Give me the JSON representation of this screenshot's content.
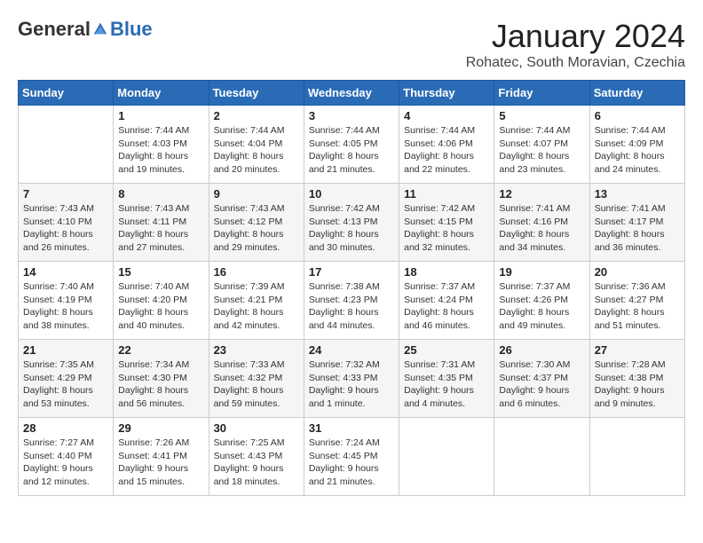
{
  "header": {
    "logo_general": "General",
    "logo_blue": "Blue",
    "month_title": "January 2024",
    "location": "Rohatec, South Moravian, Czechia"
  },
  "weekdays": [
    "Sunday",
    "Monday",
    "Tuesday",
    "Wednesday",
    "Thursday",
    "Friday",
    "Saturday"
  ],
  "weeks": [
    [
      {
        "day": "",
        "sunrise": "",
        "sunset": "",
        "daylight": ""
      },
      {
        "day": "1",
        "sunrise": "Sunrise: 7:44 AM",
        "sunset": "Sunset: 4:03 PM",
        "daylight": "Daylight: 8 hours and 19 minutes."
      },
      {
        "day": "2",
        "sunrise": "Sunrise: 7:44 AM",
        "sunset": "Sunset: 4:04 PM",
        "daylight": "Daylight: 8 hours and 20 minutes."
      },
      {
        "day": "3",
        "sunrise": "Sunrise: 7:44 AM",
        "sunset": "Sunset: 4:05 PM",
        "daylight": "Daylight: 8 hours and 21 minutes."
      },
      {
        "day": "4",
        "sunrise": "Sunrise: 7:44 AM",
        "sunset": "Sunset: 4:06 PM",
        "daylight": "Daylight: 8 hours and 22 minutes."
      },
      {
        "day": "5",
        "sunrise": "Sunrise: 7:44 AM",
        "sunset": "Sunset: 4:07 PM",
        "daylight": "Daylight: 8 hours and 23 minutes."
      },
      {
        "day": "6",
        "sunrise": "Sunrise: 7:44 AM",
        "sunset": "Sunset: 4:09 PM",
        "daylight": "Daylight: 8 hours and 24 minutes."
      }
    ],
    [
      {
        "day": "7",
        "sunrise": "Sunrise: 7:43 AM",
        "sunset": "Sunset: 4:10 PM",
        "daylight": "Daylight: 8 hours and 26 minutes."
      },
      {
        "day": "8",
        "sunrise": "Sunrise: 7:43 AM",
        "sunset": "Sunset: 4:11 PM",
        "daylight": "Daylight: 8 hours and 27 minutes."
      },
      {
        "day": "9",
        "sunrise": "Sunrise: 7:43 AM",
        "sunset": "Sunset: 4:12 PM",
        "daylight": "Daylight: 8 hours and 29 minutes."
      },
      {
        "day": "10",
        "sunrise": "Sunrise: 7:42 AM",
        "sunset": "Sunset: 4:13 PM",
        "daylight": "Daylight: 8 hours and 30 minutes."
      },
      {
        "day": "11",
        "sunrise": "Sunrise: 7:42 AM",
        "sunset": "Sunset: 4:15 PM",
        "daylight": "Daylight: 8 hours and 32 minutes."
      },
      {
        "day": "12",
        "sunrise": "Sunrise: 7:41 AM",
        "sunset": "Sunset: 4:16 PM",
        "daylight": "Daylight: 8 hours and 34 minutes."
      },
      {
        "day": "13",
        "sunrise": "Sunrise: 7:41 AM",
        "sunset": "Sunset: 4:17 PM",
        "daylight": "Daylight: 8 hours and 36 minutes."
      }
    ],
    [
      {
        "day": "14",
        "sunrise": "Sunrise: 7:40 AM",
        "sunset": "Sunset: 4:19 PM",
        "daylight": "Daylight: 8 hours and 38 minutes."
      },
      {
        "day": "15",
        "sunrise": "Sunrise: 7:40 AM",
        "sunset": "Sunset: 4:20 PM",
        "daylight": "Daylight: 8 hours and 40 minutes."
      },
      {
        "day": "16",
        "sunrise": "Sunrise: 7:39 AM",
        "sunset": "Sunset: 4:21 PM",
        "daylight": "Daylight: 8 hours and 42 minutes."
      },
      {
        "day": "17",
        "sunrise": "Sunrise: 7:38 AM",
        "sunset": "Sunset: 4:23 PM",
        "daylight": "Daylight: 8 hours and 44 minutes."
      },
      {
        "day": "18",
        "sunrise": "Sunrise: 7:37 AM",
        "sunset": "Sunset: 4:24 PM",
        "daylight": "Daylight: 8 hours and 46 minutes."
      },
      {
        "day": "19",
        "sunrise": "Sunrise: 7:37 AM",
        "sunset": "Sunset: 4:26 PM",
        "daylight": "Daylight: 8 hours and 49 minutes."
      },
      {
        "day": "20",
        "sunrise": "Sunrise: 7:36 AM",
        "sunset": "Sunset: 4:27 PM",
        "daylight": "Daylight: 8 hours and 51 minutes."
      }
    ],
    [
      {
        "day": "21",
        "sunrise": "Sunrise: 7:35 AM",
        "sunset": "Sunset: 4:29 PM",
        "daylight": "Daylight: 8 hours and 53 minutes."
      },
      {
        "day": "22",
        "sunrise": "Sunrise: 7:34 AM",
        "sunset": "Sunset: 4:30 PM",
        "daylight": "Daylight: 8 hours and 56 minutes."
      },
      {
        "day": "23",
        "sunrise": "Sunrise: 7:33 AM",
        "sunset": "Sunset: 4:32 PM",
        "daylight": "Daylight: 8 hours and 59 minutes."
      },
      {
        "day": "24",
        "sunrise": "Sunrise: 7:32 AM",
        "sunset": "Sunset: 4:33 PM",
        "daylight": "Daylight: 9 hours and 1 minute."
      },
      {
        "day": "25",
        "sunrise": "Sunrise: 7:31 AM",
        "sunset": "Sunset: 4:35 PM",
        "daylight": "Daylight: 9 hours and 4 minutes."
      },
      {
        "day": "26",
        "sunrise": "Sunrise: 7:30 AM",
        "sunset": "Sunset: 4:37 PM",
        "daylight": "Daylight: 9 hours and 6 minutes."
      },
      {
        "day": "27",
        "sunrise": "Sunrise: 7:28 AM",
        "sunset": "Sunset: 4:38 PM",
        "daylight": "Daylight: 9 hours and 9 minutes."
      }
    ],
    [
      {
        "day": "28",
        "sunrise": "Sunrise: 7:27 AM",
        "sunset": "Sunset: 4:40 PM",
        "daylight": "Daylight: 9 hours and 12 minutes."
      },
      {
        "day": "29",
        "sunrise": "Sunrise: 7:26 AM",
        "sunset": "Sunset: 4:41 PM",
        "daylight": "Daylight: 9 hours and 15 minutes."
      },
      {
        "day": "30",
        "sunrise": "Sunrise: 7:25 AM",
        "sunset": "Sunset: 4:43 PM",
        "daylight": "Daylight: 9 hours and 18 minutes."
      },
      {
        "day": "31",
        "sunrise": "Sunrise: 7:24 AM",
        "sunset": "Sunset: 4:45 PM",
        "daylight": "Daylight: 9 hours and 21 minutes."
      },
      {
        "day": "",
        "sunrise": "",
        "sunset": "",
        "daylight": ""
      },
      {
        "day": "",
        "sunrise": "",
        "sunset": "",
        "daylight": ""
      },
      {
        "day": "",
        "sunrise": "",
        "sunset": "",
        "daylight": ""
      }
    ]
  ]
}
